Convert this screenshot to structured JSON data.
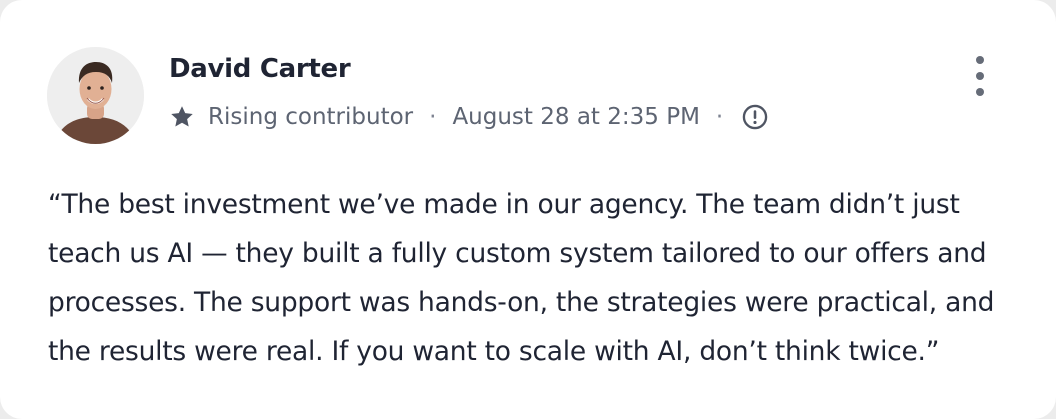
{
  "post": {
    "author_name": "David Carter",
    "badge_icon": "star-icon",
    "badge_label": "Rising contributor",
    "separator": "·",
    "timestamp": "August 28 at 2:35 PM",
    "info_icon": "info-circle-icon",
    "menu_icon": "more-vertical-icon",
    "text": "“The best investment we’ve made in our agency. The team didn’t just teach us AI — they built a fully custom system tailored to our offers and processes. The support was hands-on, the strategies were practical, and the results were real. If you want to scale with AI, don’t think twice.”"
  },
  "colors": {
    "name": "#1f2433",
    "meta": "#5d6472",
    "icon": "#4f5563",
    "card_bg": "#ffffff"
  }
}
